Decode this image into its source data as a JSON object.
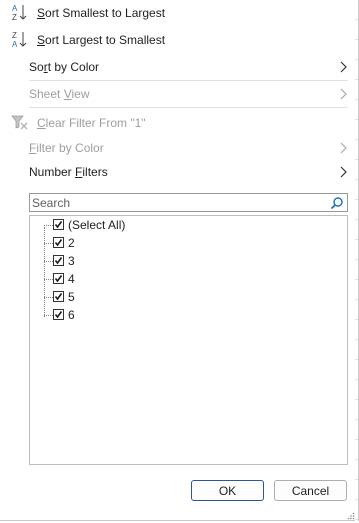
{
  "menu": {
    "sort_asc": {
      "label": "Sort Smallest to Largest",
      "icon": "sort-ascending-icon"
    },
    "sort_desc": {
      "label": "Sort Largest to Smallest",
      "icon": "sort-descending-icon"
    },
    "sort_by_color": {
      "label": "Sort by Color"
    },
    "sheet_view": {
      "label": "Sheet View",
      "disabled": true
    },
    "clear_filter": {
      "label": "Clear Filter From \"1\"",
      "disabled": true,
      "icon": "clear-filter-icon"
    },
    "filter_by_color": {
      "label": "Filter by Color",
      "disabled": true
    },
    "number_filters": {
      "label": "Number Filters"
    }
  },
  "search": {
    "placeholder": "Search",
    "value": ""
  },
  "values": [
    {
      "label": "(Select All)",
      "checked": true
    },
    {
      "label": "2",
      "checked": true
    },
    {
      "label": "3",
      "checked": true
    },
    {
      "label": "4",
      "checked": true
    },
    {
      "label": "5",
      "checked": true
    },
    {
      "label": "6",
      "checked": true
    }
  ],
  "buttons": {
    "ok": "OK",
    "cancel": "Cancel"
  },
  "colors": {
    "accent": "#2b5797",
    "disabled_text": "#9e9e9e",
    "sort_icon_blue": "#1e6fc4"
  }
}
